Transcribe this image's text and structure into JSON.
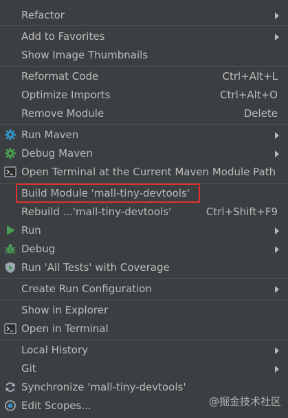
{
  "menu": {
    "items": [
      {
        "label": "Refactor",
        "shortcut": ""
      },
      {
        "label": "Add to Favorites",
        "shortcut": ""
      },
      {
        "label": "Show Image Thumbnails",
        "shortcut": ""
      },
      {
        "label": "Reformat Code",
        "shortcut": "Ctrl+Alt+L"
      },
      {
        "label": "Optimize Imports",
        "shortcut": "Ctrl+Alt+O"
      },
      {
        "label": "Remove Module",
        "shortcut": "Delete"
      },
      {
        "label": "Run Maven",
        "shortcut": ""
      },
      {
        "label": "Debug Maven",
        "shortcut": ""
      },
      {
        "label": "Open Terminal at the Current Maven Module Path",
        "shortcut": ""
      },
      {
        "label": "Build Module 'mall-tiny-devtools'",
        "shortcut": ""
      },
      {
        "label": "Rebuild ...'mall-tiny-devtools'",
        "shortcut": "Ctrl+Shift+F9"
      },
      {
        "label": "Run",
        "shortcut": ""
      },
      {
        "label": "Debug",
        "shortcut": ""
      },
      {
        "label": "Run 'All Tests' with Coverage",
        "shortcut": ""
      },
      {
        "label": "Create Run Configuration",
        "shortcut": ""
      },
      {
        "label": "Show in Explorer",
        "shortcut": ""
      },
      {
        "label": "Open in Terminal",
        "shortcut": ""
      },
      {
        "label": "Local History",
        "shortcut": ""
      },
      {
        "label": "Git",
        "shortcut": ""
      },
      {
        "label": "Synchronize 'mall-tiny-devtools'",
        "shortcut": ""
      },
      {
        "label": "Edit Scopes...",
        "shortcut": ""
      }
    ]
  },
  "icons": {
    "run_maven": "gear-icon",
    "debug_maven": "gear-icon",
    "open_terminal_maven": "terminal-icon",
    "run": "play-icon",
    "debug": "bug-icon",
    "coverage": "shield-play-icon",
    "open_in_terminal": "terminal-icon",
    "synchronize": "refresh-icon",
    "edit_scopes": "scope-icon"
  },
  "colors": {
    "background": "#3c3f41",
    "text": "#bbbbbb",
    "separator": "#515151",
    "highlight_box": "#e12f2f",
    "maven_gear": "#3592c4",
    "run_green": "#499c54"
  },
  "watermark": "@掘金技术社区"
}
